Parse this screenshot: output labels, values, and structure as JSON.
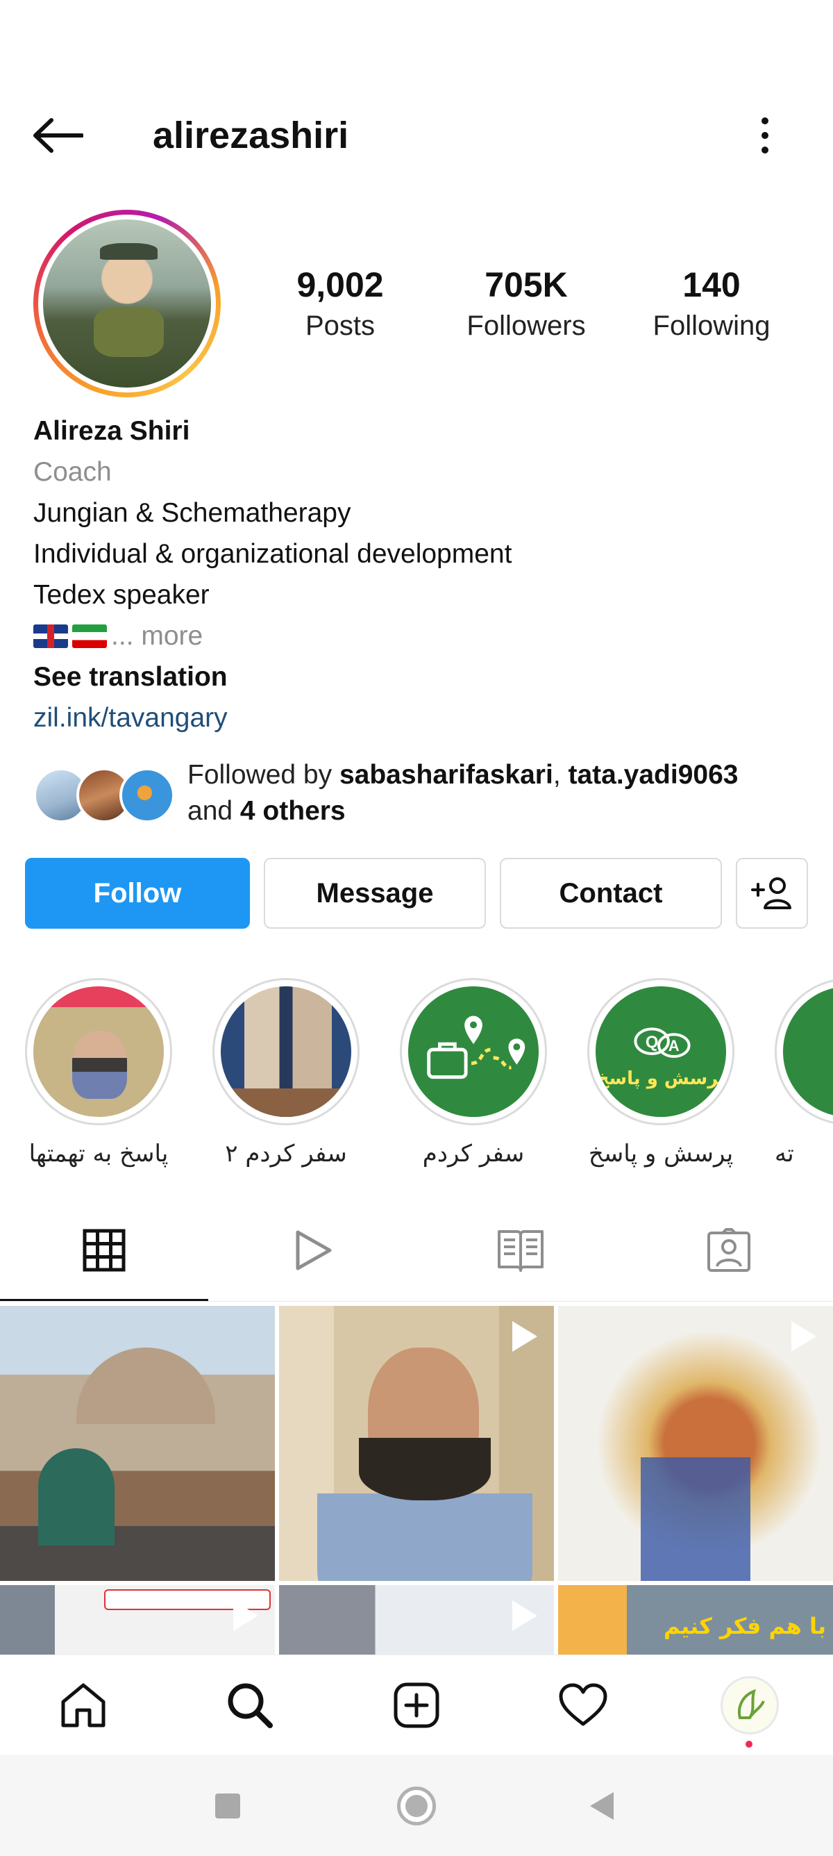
{
  "header": {
    "username": "alirezashiri"
  },
  "stats": {
    "posts": {
      "value": "9,002",
      "label": "Posts"
    },
    "followers": {
      "value": "705K",
      "label": "Followers"
    },
    "following": {
      "value": "140",
      "label": "Following"
    }
  },
  "bio": {
    "name": "Alireza Shiri",
    "category": "Coach",
    "lines": [
      "Jungian & Schematherapy",
      "Individual & organizational development",
      "Tedex speaker"
    ],
    "more": "... more",
    "see_translation": "See translation",
    "link": "zil.ink/tavangary"
  },
  "followed_by": {
    "prefix": "Followed by ",
    "user1": "sabasharifaskari",
    "separator": ", ",
    "user2": "tata.yadi9063",
    "middle": "and ",
    "others": "4 others"
  },
  "buttons": {
    "follow": "Follow",
    "message": "Message",
    "contact": "Contact"
  },
  "highlights": [
    {
      "label": "پاسخ به تهمتها"
    },
    {
      "label": "سفر کردم ۲"
    },
    {
      "label": "سفر کردم"
    },
    {
      "label": "پرسش و پاسخ"
    },
    {
      "label": "ته"
    }
  ],
  "highlight_texts": {
    "qa": "پرسش و پاسخ"
  },
  "grid_texts": {
    "cell6": "با هم فکر کنیم"
  },
  "colors": {
    "follow_blue": "#1e97f4",
    "link_blue": "#1f4e79",
    "highlight_green": "#2f8a3f",
    "notification_red": "#ed2a55"
  }
}
